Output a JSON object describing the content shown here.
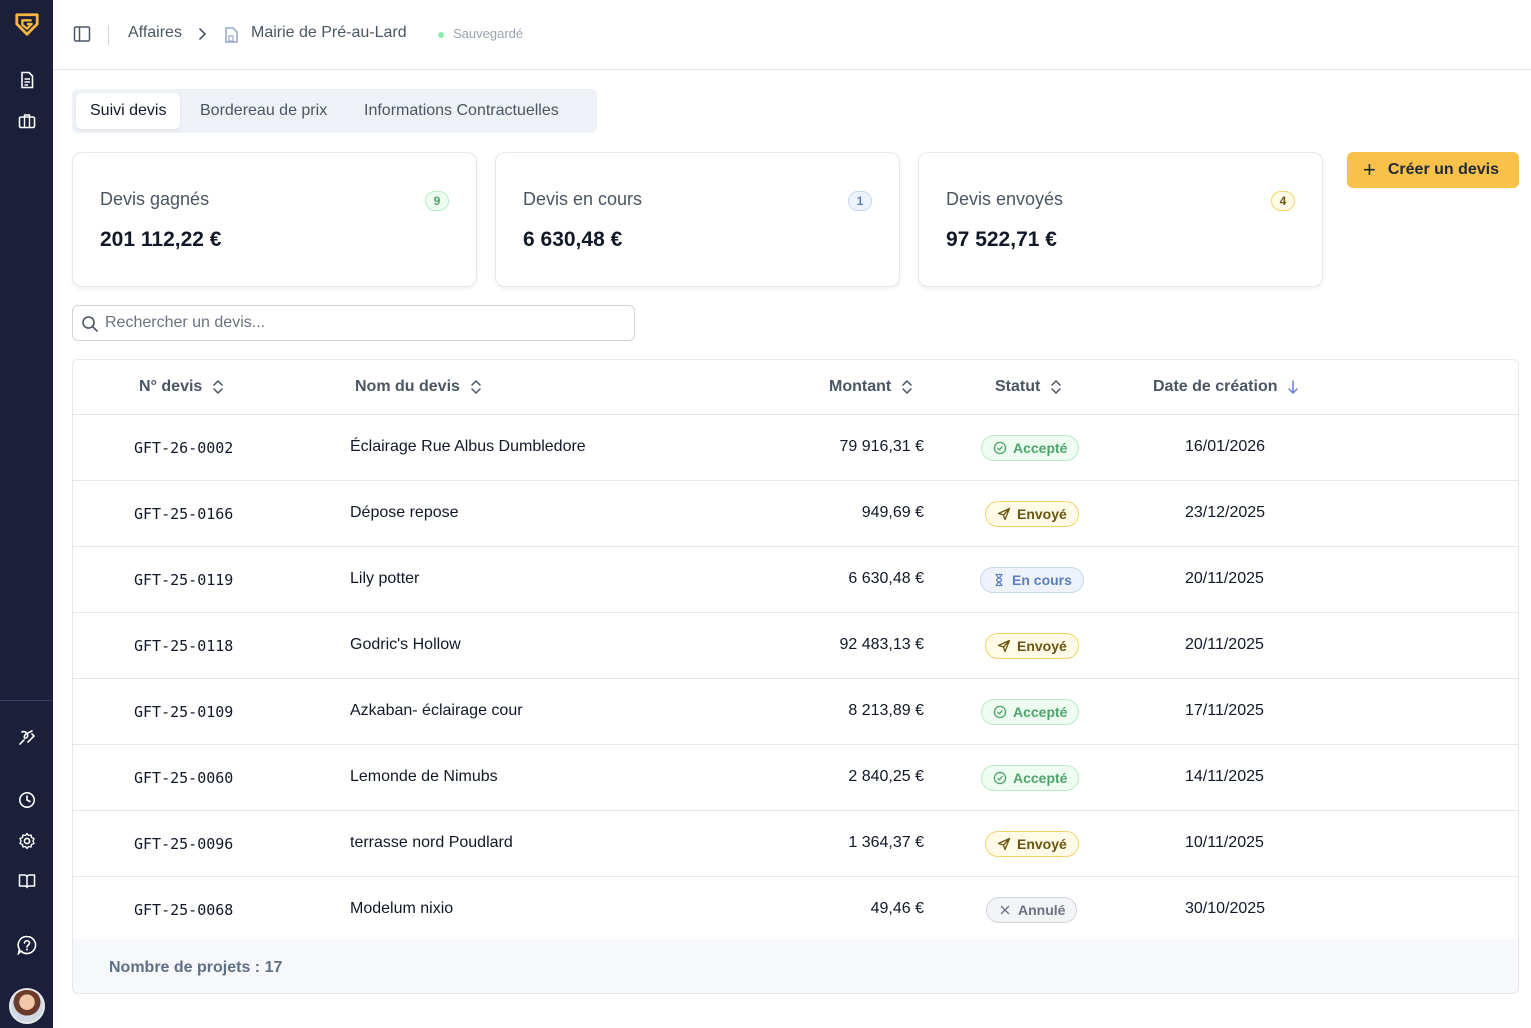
{
  "header": {
    "crumb_1": "Affaires",
    "crumb_2": "Mairie de Pré-au-Lard",
    "status": "Sauvegardé"
  },
  "tabs": [
    {
      "label": "Suivi devis",
      "active": true
    },
    {
      "label": "Bordereau de prix",
      "active": false
    },
    {
      "label": "Informations Contractuelles",
      "active": false
    }
  ],
  "cards": [
    {
      "title": "Devis gagnés",
      "amount": "201 112,22 €",
      "count": "9",
      "color": "#4ea36b"
    },
    {
      "title": "Devis en cours",
      "amount": "6 630,48 €",
      "count": "1",
      "color": "#5b7fb9"
    },
    {
      "title": "Devis envoyés",
      "amount": "97 522,71 €",
      "count": "4",
      "color": "#8a6a10"
    }
  ],
  "create_button": "Créer un devis",
  "search": {
    "placeholder": "Rechercher un devis...",
    "value": ""
  },
  "table": {
    "headers": {
      "number": "N° devis",
      "name": "Nom du devis",
      "amount": "Montant",
      "status": "Statut",
      "date": "Date de création"
    },
    "rows": [
      {
        "number": "GFT-26-0002",
        "name": "Éclairage Rue Albus Dumbledore",
        "amount": "79 916,31 €",
        "status": "Accepté",
        "status_type": "accepted",
        "date": "16/01/2026"
      },
      {
        "number": "GFT-25-0166",
        "name": "Dépose repose",
        "amount": "949,69 €",
        "status": "Envoyé",
        "status_type": "sent",
        "date": "23/12/2025"
      },
      {
        "number": "GFT-25-0119",
        "name": "Lily potter",
        "amount": "6 630,48 €",
        "status": "En cours",
        "status_type": "progress",
        "date": "20/11/2025"
      },
      {
        "number": "GFT-25-0118",
        "name": "Godric's Hollow",
        "amount": "92 483,13 €",
        "status": "Envoyé",
        "status_type": "sent",
        "date": "20/11/2025"
      },
      {
        "number": "GFT-25-0109",
        "name": "Azkaban- éclairage cour",
        "amount": "8 213,89 €",
        "status": "Accepté",
        "status_type": "accepted",
        "date": "17/11/2025"
      },
      {
        "number": "GFT-25-0060",
        "name": "Lemonde de Nimubs",
        "amount": "2 840,25 €",
        "status": "Accepté",
        "status_type": "accepted",
        "date": "14/11/2025"
      },
      {
        "number": "GFT-25-0096",
        "name": "terrasse nord Poudlard",
        "amount": "1 364,37 €",
        "status": "Envoyé",
        "status_type": "sent",
        "date": "10/11/2025"
      },
      {
        "number": "GFT-25-0068",
        "name": "Modelum nixio",
        "amount": "49,46 €",
        "status": "Annulé",
        "status_type": "cancel",
        "date": "30/10/2025"
      }
    ],
    "footer": "Nombre de projets : 17"
  },
  "colors": {
    "sidebar": "#1c1f3a",
    "accent": "#f7c14a",
    "logo": "#f5b53f"
  }
}
